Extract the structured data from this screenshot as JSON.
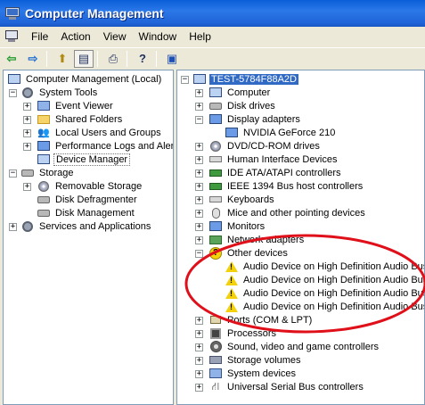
{
  "window": {
    "title": "Computer Management"
  },
  "menu": [
    "File",
    "Action",
    "View",
    "Window",
    "Help"
  ],
  "toolbar": {
    "back_icon": "arrow-left-icon",
    "forward_icon": "arrow-right-icon",
    "buttons": [
      "up-folder-icon",
      "show-hide-tree-icon",
      "print-icon",
      "help-icon",
      "properties-icon"
    ]
  },
  "left_tree": {
    "root": "Computer Management (Local)",
    "system_tools": {
      "label": "System Tools",
      "items": [
        "Event Viewer",
        "Shared Folders",
        "Local Users and Groups",
        "Performance Logs and Alerts",
        "Device Manager"
      ]
    },
    "storage": {
      "label": "Storage",
      "items": [
        "Removable Storage",
        "Disk Defragmenter",
        "Disk Management"
      ]
    },
    "services": "Services and Applications"
  },
  "device_tree": {
    "root": "TEST-5784F88A2D",
    "categories": [
      "Computer",
      "Disk drives",
      "Display adapters",
      "NVIDIA GeForce 210",
      "DVD/CD-ROM drives",
      "Human Interface Devices",
      "IDE ATA/ATAPI controllers",
      "IEEE 1394 Bus host controllers",
      "Keyboards",
      "Mice and other pointing devices",
      "Monitors",
      "Network adapters",
      "Other devices",
      "Audio Device on High Definition Audio Bus",
      "Audio Device on High Definition Audio Bus",
      "Audio Device on High Definition Audio Bus",
      "Audio Device on High Definition Audio Bus",
      "Ports (COM & LPT)",
      "Processors",
      "Sound, video and game controllers",
      "Storage volumes",
      "System devices",
      "Universal Serial Bus controllers"
    ]
  },
  "colors": {
    "title_bar": "#1f64d8",
    "selection": "#316ac5",
    "annotation": "#e0101a",
    "warning": "#f3d20c"
  }
}
